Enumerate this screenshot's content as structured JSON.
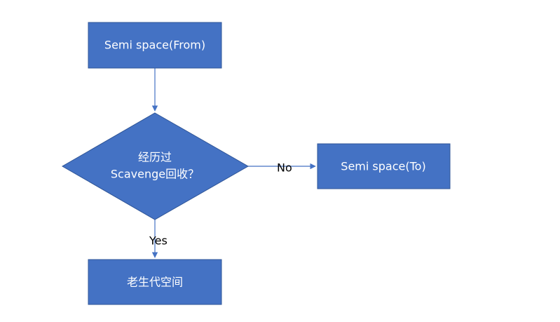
{
  "colors": {
    "node_fill": "#4472C4",
    "node_stroke": "#2F5597",
    "edge": "#4472C4",
    "node_text": "#FFFFFF",
    "label_text": "#000000"
  },
  "nodes": {
    "from": {
      "label": "Semi space(From)"
    },
    "decision": {
      "line1": "经历过",
      "line2": "Scavenge回收？"
    },
    "to": {
      "label": "Semi space(To)"
    },
    "old": {
      "label": "老生代空间"
    }
  },
  "edges": {
    "no_label": "No",
    "yes_label": "Yes"
  }
}
